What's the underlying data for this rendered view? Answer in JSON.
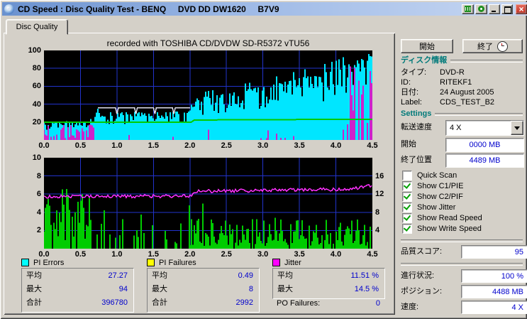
{
  "titlebar": {
    "title": "CD Speed : Disc Quality Test - BENQ     DVD DD DW1620     B7V9"
  },
  "tab": {
    "label": "Disc Quality"
  },
  "chart_header": "recorded with TOSHIBA CD/DVDW SD-R5372 vTU56",
  "actions": {
    "start": "開始",
    "exit": "終了"
  },
  "disc_info": {
    "header": "ディスク情報",
    "rows": [
      {
        "label": "タイプ:",
        "value": "DVD-R"
      },
      {
        "label": "ID:",
        "value": "RITEKF1"
      },
      {
        "label": "日付:",
        "value": "24 August 2005"
      },
      {
        "label": "Label:",
        "value": "CDS_TEST_B2"
      }
    ]
  },
  "settings": {
    "header": "Settings",
    "speed_label": "転送速度",
    "speed_value": "4 X",
    "start_label": "開始",
    "start_value": "0000 MB",
    "end_label": "終了位置",
    "end_value": "4489 MB",
    "checkboxes": [
      {
        "label": "Quick Scan",
        "checked": false
      },
      {
        "label": "Show C1/PIE",
        "checked": true
      },
      {
        "label": "Show C2/PIF",
        "checked": true
      },
      {
        "label": "Show Jitter",
        "checked": true
      },
      {
        "label": "Show Read Speed",
        "checked": true
      },
      {
        "label": "Show Write Speed",
        "checked": true
      }
    ]
  },
  "status": {
    "score_label": "品質スコア:",
    "score_value": "95",
    "progress_label": "進行状況:",
    "progress_value": "100 %",
    "position_label": "ポジション:",
    "position_value": "4488 MB",
    "speed_label": "速度:",
    "speed_value": "4 X"
  },
  "stats": {
    "pi_errors": {
      "label": "PI Errors",
      "color": "#00ffff",
      "rows": [
        [
          "平均",
          "27.27"
        ],
        [
          "最大",
          "94"
        ],
        [
          "合計",
          "396780"
        ]
      ]
    },
    "pi_failures": {
      "label": "PI Failures",
      "color": "#ffff00",
      "rows": [
        [
          "平均",
          "0.49"
        ],
        [
          "最大",
          "8"
        ],
        [
          "合計",
          "2992"
        ]
      ]
    },
    "jitter": {
      "label": "Jitter",
      "color": "#ff00ff",
      "rows": [
        [
          "平均",
          "11.51 %"
        ],
        [
          "最大",
          "14.5 %"
        ]
      ],
      "po_label": "PO Failures:",
      "po_value": "0"
    }
  },
  "chart_data": [
    {
      "name": "pi-errors-chart",
      "type": "area",
      "xlim": [
        0,
        4.5
      ],
      "ylim": [
        0,
        100
      ],
      "x_ticks": [
        "0.0",
        "0.5",
        "1.0",
        "1.5",
        "2.0",
        "2.5",
        "3.0",
        "3.5",
        "4.0",
        "4.5"
      ],
      "y_ticks": [
        20,
        40,
        60,
        80,
        100
      ],
      "grid_color": "#2233cc",
      "series": [
        {
          "name": "PI Errors",
          "type": "spiky-area",
          "color": "#00e6ff",
          "jag": 0.45,
          "seed": 7,
          "points": [
            [
              0,
              21
            ],
            [
              0.68,
              21
            ],
            [
              0.72,
              31
            ],
            [
              1.99,
              32
            ],
            [
              2.05,
              46
            ],
            [
              2.5,
              52
            ],
            [
              3.0,
              60
            ],
            [
              3.5,
              69
            ],
            [
              4.0,
              79
            ],
            [
              4.3,
              90
            ],
            [
              4.5,
              98
            ]
          ]
        },
        {
          "name": "PI Failures overlay",
          "type": "spikes",
          "color": "#cc22cc",
          "seed": 11,
          "segments": [
            {
              "x0": 0,
              "x1": 0.68,
              "density": 0.8,
              "min": 2,
              "max": 18,
              "pow": 1.2
            },
            {
              "x0": 0.72,
              "x1": 4.1,
              "density": 0.05,
              "min": 2,
              "max": 12,
              "pow": 1.2
            },
            {
              "x0": 4.12,
              "x1": 4.5,
              "density": 0.5,
              "min": 15,
              "max": 85,
              "pow": 0.9
            }
          ]
        },
        {
          "name": "Write Speed",
          "type": "line",
          "color": "#00cc00",
          "width": 2,
          "points": [
            [
              0,
              20
            ],
            [
              2.02,
              20
            ],
            [
              2.06,
              22.3
            ],
            [
              4.5,
              23.2
            ]
          ]
        },
        {
          "name": "Read Speed",
          "type": "notched-line",
          "color": "#e0e0f0",
          "width": 1.5,
          "y": 36,
          "x0": 0.74,
          "x1": 2.0,
          "interval": 0.26,
          "depth": 7
        }
      ]
    },
    {
      "name": "jitter-chart",
      "type": "area",
      "xlim": [
        0,
        4.5
      ],
      "ylim": [
        0,
        10
      ],
      "x_ticks": [
        "0.0",
        "0.5",
        "1.0",
        "1.5",
        "2.0",
        "2.5",
        "3.0",
        "3.5",
        "4.0",
        "4.5"
      ],
      "y_ticks": [
        2,
        4,
        6,
        8,
        10
      ],
      "y_ticks_right": [
        {
          "label": "4",
          "value": 2
        },
        {
          "label": "8",
          "value": 4
        },
        {
          "label": "12",
          "value": 6
        },
        {
          "label": "16",
          "value": 8
        }
      ],
      "grid_color": "#2233cc",
      "series": [
        {
          "name": "PI Failures",
          "type": "spikes",
          "color": "#00cc00",
          "seed": 3,
          "segments": [
            {
              "x0": 0,
              "x1": 0.65,
              "density": 0.95,
              "min": 0.8,
              "max": 6.8,
              "pow": 0.8
            },
            {
              "x0": 0.65,
              "x1": 2.0,
              "density": 0.22,
              "min": 0.5,
              "max": 5.5,
              "pow": 1.5
            },
            {
              "x0": 2.0,
              "x1": 4.5,
              "density": 0.92,
              "min": 0.3,
              "max": 3.3,
              "pow": 1.3
            },
            {
              "x0": 2.0,
              "x1": 4.5,
              "density": 0.05,
              "min": 3,
              "max": 5,
              "pow": 1.0
            }
          ]
        },
        {
          "name": "Jitter",
          "type": "noisy-line",
          "color": "#ff30ff",
          "width": 1.5,
          "noise": 0.18,
          "seed": 5,
          "points": [
            [
              0,
              5.72
            ],
            [
              2.0,
              5.78
            ],
            [
              2.12,
              6.3
            ],
            [
              4.2,
              6.55
            ],
            [
              4.5,
              7.0
            ]
          ]
        }
      ]
    }
  ]
}
